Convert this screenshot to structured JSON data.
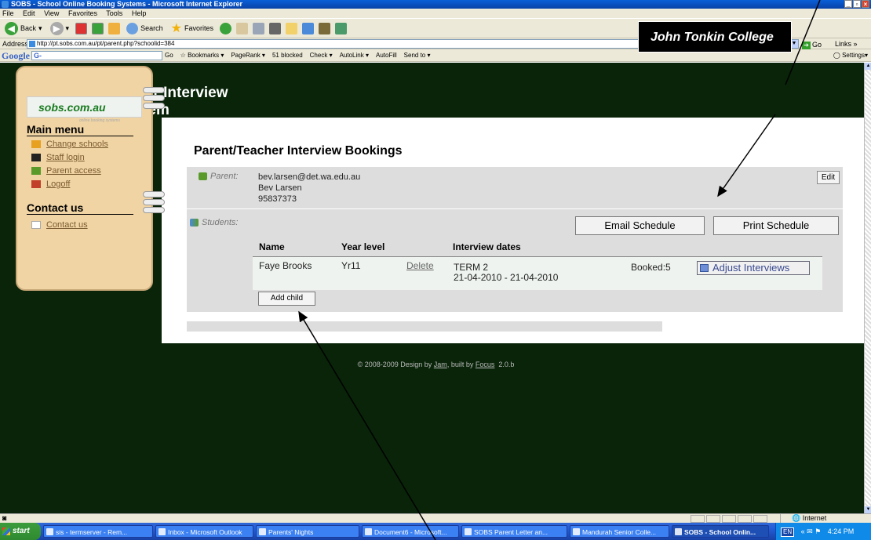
{
  "window": {
    "title": "SOBS - School Online Booking Systems - Microsoft Internet Explorer",
    "controls": [
      "_",
      "▫",
      "×"
    ]
  },
  "menubar": [
    "File",
    "Edit",
    "View",
    "Favorites",
    "Tools",
    "Help"
  ],
  "toolbar": {
    "back": "Back",
    "search": "Search",
    "favorites": "Favorites"
  },
  "address": {
    "label": "Address",
    "url": "http://pt.sobs.com.au/pt/parent.php?schoolid=384",
    "go": "Go",
    "links": "Links"
  },
  "googlebar": {
    "logo": "Google",
    "box": "G-",
    "go": "Go",
    "bookmarks": "Bookmarks",
    "pagerank": "PageRank",
    "blocked": "51 blocked",
    "check": "Check",
    "autolink": "AutoLink",
    "autofill": "AutoFill",
    "sendto": "Send to",
    "settings": "Settings"
  },
  "header": {
    "title_line1": "Parent/Teacher Interview",
    "title_line2": "Booking System",
    "school": "John Tonkin College"
  },
  "sidebar": {
    "logo_text": "sobs.com.au",
    "logo_sub": "online booking systems",
    "main_menu_heading": "Main menu",
    "items": [
      {
        "label": "Change schools",
        "icon": "pencil-icon"
      },
      {
        "label": "Staff login",
        "icon": "hat-icon"
      },
      {
        "label": "Parent access",
        "icon": "person-icon"
      },
      {
        "label": "Logoff",
        "icon": "door-icon"
      }
    ],
    "contact_heading": "Contact us",
    "contact_item": "Contact us"
  },
  "main": {
    "heading": "Parent/Teacher Interview Bookings",
    "parent_label": "Parent:",
    "parent_email": "bev.larsen@det.wa.edu.au",
    "parent_name": "Bev Larsen",
    "parent_phone": "95837373",
    "edit_label": "Edit",
    "students_label": "Students:",
    "email_schedule": "Email Schedule",
    "print_schedule": "Print Schedule",
    "columns": {
      "name": "Name",
      "year": "Year level",
      "dates": "Interview dates"
    },
    "student": {
      "name": "Faye Brooks",
      "year": "Yr11",
      "delete": "Delete",
      "term": "TERM 2",
      "range": "21-04-2010 - 21-04-2010",
      "booked": "Booked:5",
      "adjust": "Adjust Interviews"
    },
    "add_child": "Add child"
  },
  "footer": {
    "prefix": "© 2008-2009 Design by",
    "design_link": "Jam",
    "mid": ", built by",
    "built_link": "Focus",
    "version": "2.0.b"
  },
  "status": {
    "zone": "Internet"
  },
  "taskbar": {
    "start": "start",
    "tasks": [
      "sis - termserver - Rem...",
      "Inbox - Microsoft Outlook",
      "Parents' Nights",
      "Document6 - Microsoft...",
      "SOBS Parent Letter an...",
      "Mandurah Senior Colle...",
      "SOBS - School Onlin..."
    ],
    "lang": "EN",
    "clock": "4:24 PM"
  },
  "colors": {
    "page_bg": "#092409",
    "sidebar_bg": "#f0d4a4",
    "panel_bg": "#dddddd",
    "xp_blue": "#245edb"
  }
}
